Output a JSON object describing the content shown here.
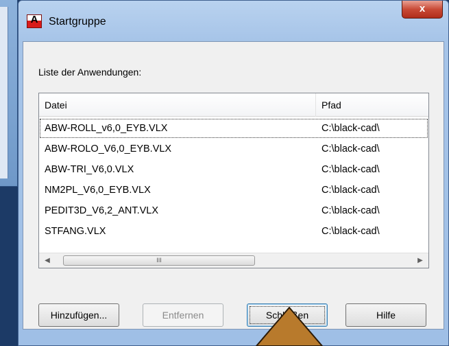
{
  "dialog": {
    "title": "Startgruppe",
    "app_icon_letter": "A",
    "close_label": "x"
  },
  "list": {
    "caption": "Liste der Anwendungen:",
    "columns": {
      "file": "Datei",
      "path": "Pfad"
    },
    "rows": [
      {
        "file": "ABW-ROLL_v6,0_EYB.VLX",
        "path": "C:\\black-cad\\"
      },
      {
        "file": "ABW-ROLO_V6,0_EYB.VLX",
        "path": "C:\\black-cad\\"
      },
      {
        "file": "ABW-TRI_V6,0.VLX",
        "path": "C:\\black-cad\\"
      },
      {
        "file": "NM2PL_V6,0_EYB.VLX",
        "path": "C:\\black-cad\\"
      },
      {
        "file": "PEDIT3D_V6,2_ANT.VLX",
        "path": "C:\\black-cad\\"
      },
      {
        "file": "STFANG.VLX",
        "path": "C:\\black-cad\\"
      }
    ],
    "scroll_thumb_grip": "III"
  },
  "buttons": {
    "add": "Hinzufügen...",
    "remove": "Entfernen",
    "close": "Schließen",
    "help": "Hilfe"
  },
  "colors": {
    "titlebar": "#a6c4e8",
    "close_button": "#c94a36",
    "pointer": "#b87a2c"
  }
}
